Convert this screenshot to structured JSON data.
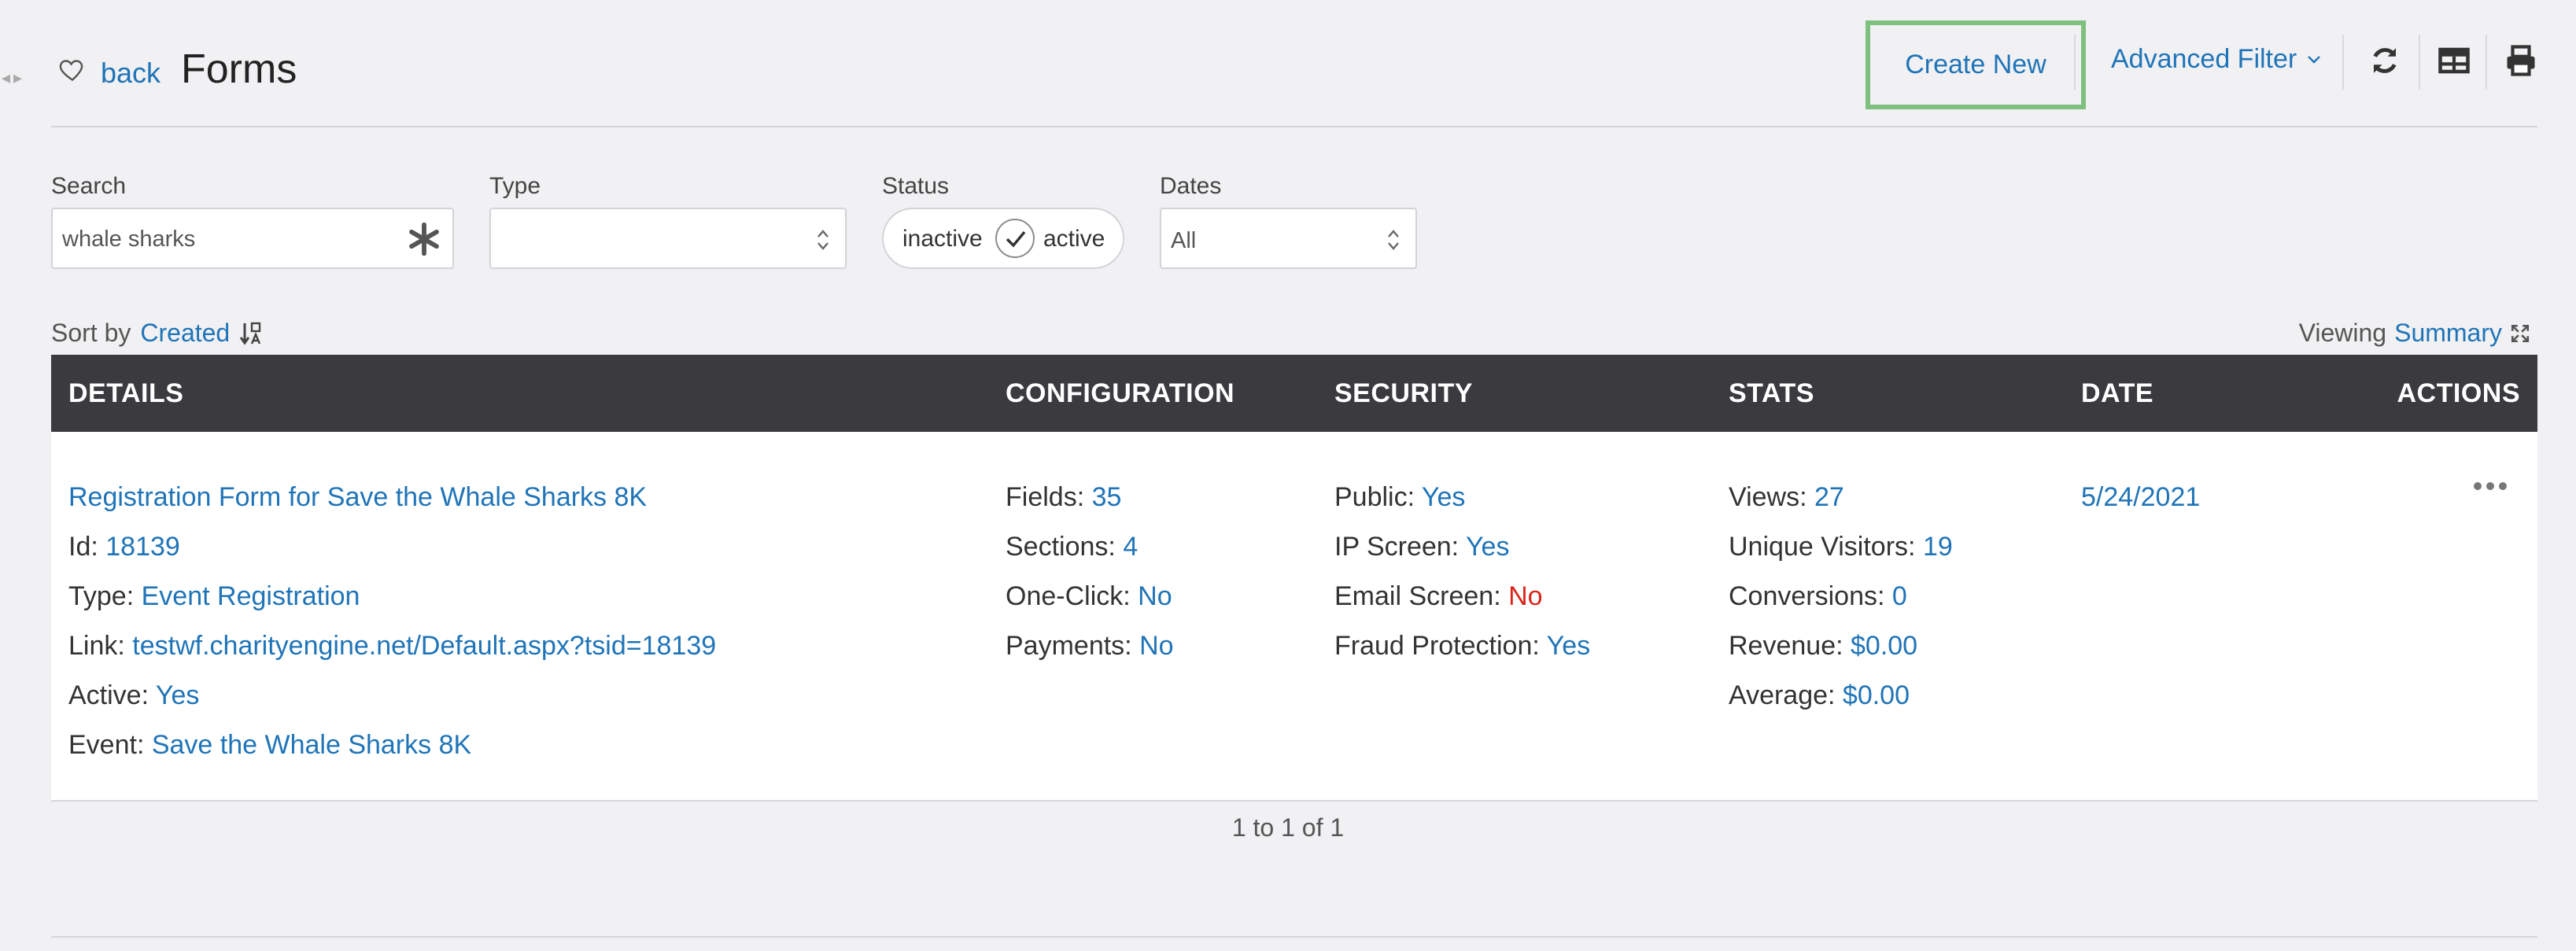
{
  "header": {
    "back_label": "back",
    "title": "Forms",
    "create_new_label": "Create New",
    "advanced_filter_label": "Advanced Filter",
    "icons": [
      "chevron-left-right-icon",
      "heart-icon",
      "chevron-down-icon",
      "refresh-icon",
      "table-icon",
      "print-icon"
    ]
  },
  "filters": {
    "search": {
      "label": "Search",
      "value": "whale sharks"
    },
    "type": {
      "label": "Type",
      "value": ""
    },
    "status": {
      "label": "Status",
      "inactive_label": "inactive",
      "active_label": "active",
      "selected": "active"
    },
    "dates": {
      "label": "Dates",
      "value": "All"
    }
  },
  "sort": {
    "prefix": "Sort by",
    "field": "Created"
  },
  "viewing": {
    "prefix": "Viewing",
    "mode": "Summary"
  },
  "table": {
    "headers": [
      "DETAILS",
      "CONFIGURATION",
      "SECURITY",
      "STATS",
      "DATE",
      "ACTIONS"
    ],
    "row": {
      "details": {
        "title": "Registration Form for Save the Whale Sharks 8K",
        "id_label": "Id:",
        "id_value": "18139",
        "type_label": "Type:",
        "type_value": "Event Registration",
        "link_label": "Link:",
        "link_value": "testwf.charityengine.net/Default.aspx?tsid=18139",
        "active_label": "Active:",
        "active_value": "Yes",
        "event_label": "Event:",
        "event_value": "Save the Whale Sharks 8K"
      },
      "configuration": {
        "fields_label": "Fields:",
        "fields_value": "35",
        "sections_label": "Sections:",
        "sections_value": "4",
        "oneclick_label": "One-Click:",
        "oneclick_value": "No",
        "payments_label": "Payments:",
        "payments_value": "No"
      },
      "security": {
        "public_label": "Public:",
        "public_value": "Yes",
        "ip_label": "IP Screen:",
        "ip_value": "Yes",
        "email_label": "Email Screen:",
        "email_value": "No",
        "fraud_label": "Fraud Protection:",
        "fraud_value": "Yes"
      },
      "stats": {
        "views_label": "Views:",
        "views_value": "27",
        "unique_label": "Unique Visitors:",
        "unique_value": "19",
        "conv_label": "Conversions:",
        "conv_value": "0",
        "revenue_label": "Revenue:",
        "revenue_value": "$0.00",
        "average_label": "Average:",
        "average_value": "$0.00"
      },
      "date": "5/24/2021"
    }
  },
  "pager": {
    "text": "1 to 1 of 1"
  },
  "colors": {
    "link": "#1f74b8",
    "negative": "#d9261c",
    "header_bg": "#3a3a3f",
    "highlight_border": "#7ec07e"
  }
}
